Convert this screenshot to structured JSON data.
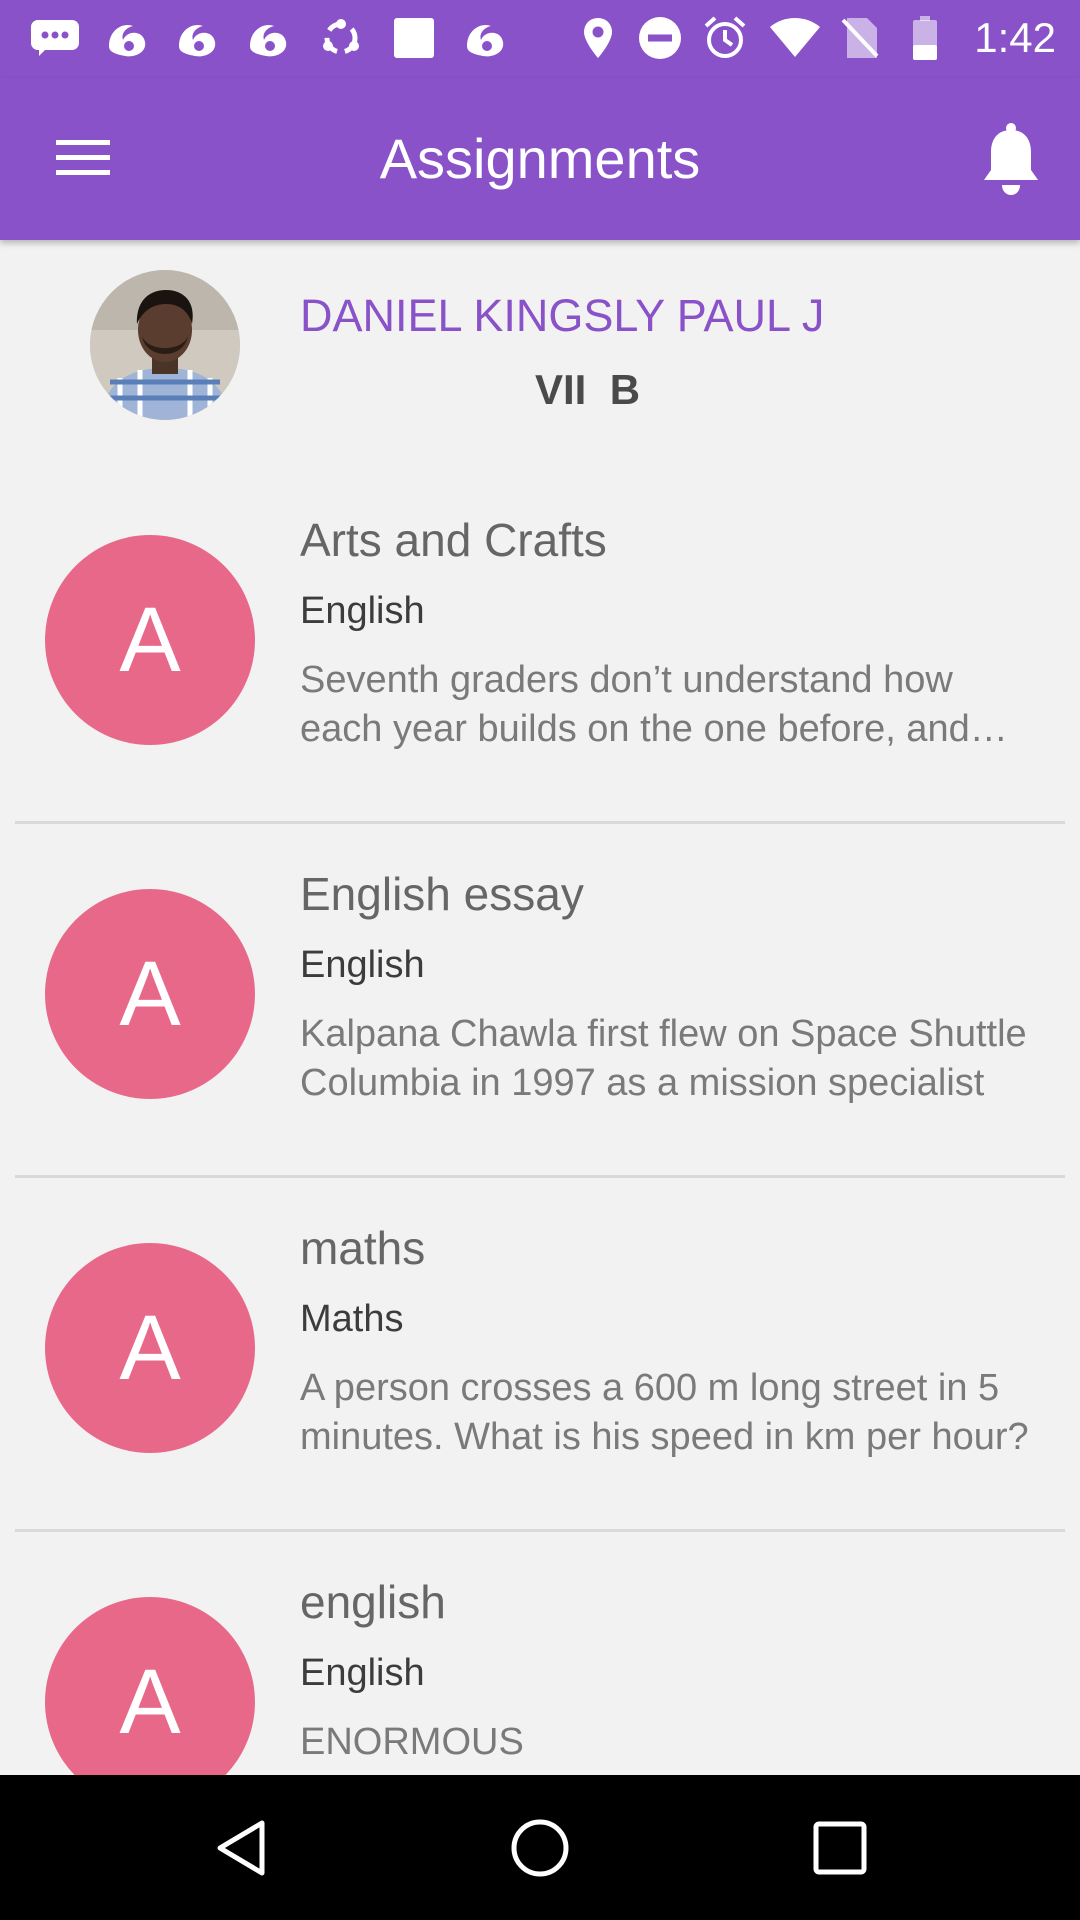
{
  "status_bar": {
    "time": "1:42",
    "left_icons": [
      "message-icon",
      "uc-browser-icon",
      "uc-browser-icon",
      "uc-browser-icon",
      "sync-icon",
      "square-icon",
      "uc-browser-icon"
    ],
    "right_icons": [
      "location-icon",
      "do-not-disturb-icon",
      "alarm-icon",
      "wifi-icon",
      "no-sim-icon",
      "battery-icon"
    ]
  },
  "app_bar": {
    "title": "Assignments",
    "menu_icon": "hamburger-menu-icon",
    "notification_icon": "bell-icon"
  },
  "profile": {
    "name": "DANIEL KINGSLY PAUL J",
    "class_section": "VII  B"
  },
  "assignments": [
    {
      "avatar_letter": "A",
      "title": "Arts and Crafts",
      "subject": "English",
      "description": "Seventh graders don’t understand how each year builds on the one before, and why that matters"
    },
    {
      "avatar_letter": "A",
      "title": "English essay",
      "subject": "English",
      "description": "Kalpana Chawla first flew on Space Shuttle Columbia in 1997 as a mission specialist"
    },
    {
      "avatar_letter": "A",
      "title": "maths",
      "subject": "Maths",
      "description": "A person crosses a 600 m long street in 5 minutes. What is his speed in km per hour?"
    },
    {
      "avatar_letter": "A",
      "title": "english",
      "subject": "English",
      "description": "ENORMOUS"
    }
  ],
  "nav_bar": {
    "icons": [
      "back-icon",
      "home-icon",
      "recents-icon"
    ]
  },
  "colors": {
    "primary": "#8a52c8",
    "avatar": "#e8688a",
    "background": "#f2f2f2"
  }
}
